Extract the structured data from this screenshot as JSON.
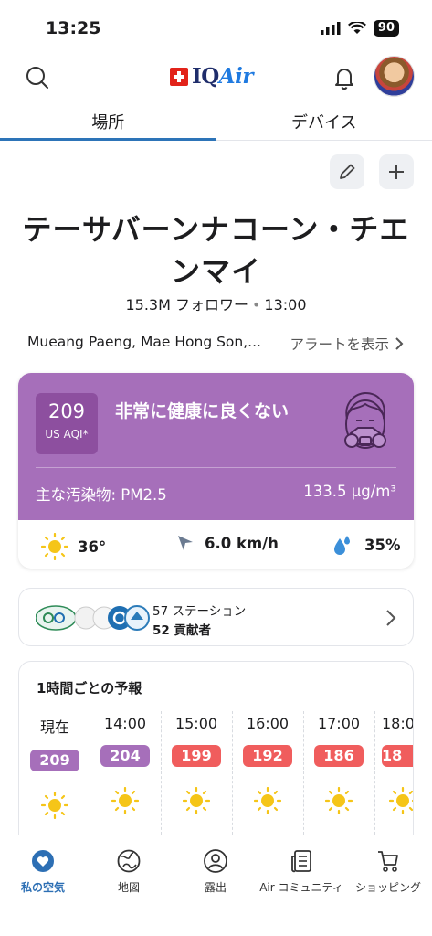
{
  "status_bar": {
    "time": "13:25",
    "battery": "90"
  },
  "header": {
    "logo_text_main": "IQ",
    "logo_text_air": "Air"
  },
  "tabs": [
    {
      "label": "場所"
    },
    {
      "label": "デバイス"
    }
  ],
  "location": {
    "title": "テーサバーンナコーン・チエンマイ",
    "followers": "15.3M フォロワー",
    "time": "13:00",
    "region": "Mueang Paeng, Mae Hong Son,...",
    "alert_link": "アラートを表示"
  },
  "aqi": {
    "value": "209",
    "unit": "US AQI*",
    "status": "非常に健康に良くない",
    "pollutant_label": "主な汚染物: PM2.5",
    "pollutant_value": "133.5 µg/m³",
    "color": "#a66fba"
  },
  "weather": {
    "temperature": "36°",
    "wind": "6.0 km/h",
    "humidity": "35%"
  },
  "stations": {
    "count": "57 ステーション",
    "contributors": "52 貢献者"
  },
  "forecast": {
    "title": "1時間ごとの予報",
    "hours": [
      {
        "time": "現在",
        "aqi": "209",
        "color": "#a66fba"
      },
      {
        "time": "14:00",
        "aqi": "204",
        "color": "#a66fba"
      },
      {
        "time": "15:00",
        "aqi": "199",
        "color": "#f05d5d"
      },
      {
        "time": "16:00",
        "aqi": "192",
        "color": "#f05d5d"
      },
      {
        "time": "17:00",
        "aqi": "186",
        "color": "#f05d5d"
      },
      {
        "time": "18:0",
        "aqi": "18",
        "color": "#f05d5d"
      }
    ]
  },
  "nav": [
    {
      "label": "私の空気",
      "icon": "heart-shield-icon"
    },
    {
      "label": "地図",
      "icon": "globe-icon"
    },
    {
      "label": "露出",
      "icon": "exposure-icon"
    },
    {
      "label": "Air コミュニティ",
      "icon": "news-icon"
    },
    {
      "label": "ショッピング",
      "icon": "cart-icon"
    }
  ]
}
